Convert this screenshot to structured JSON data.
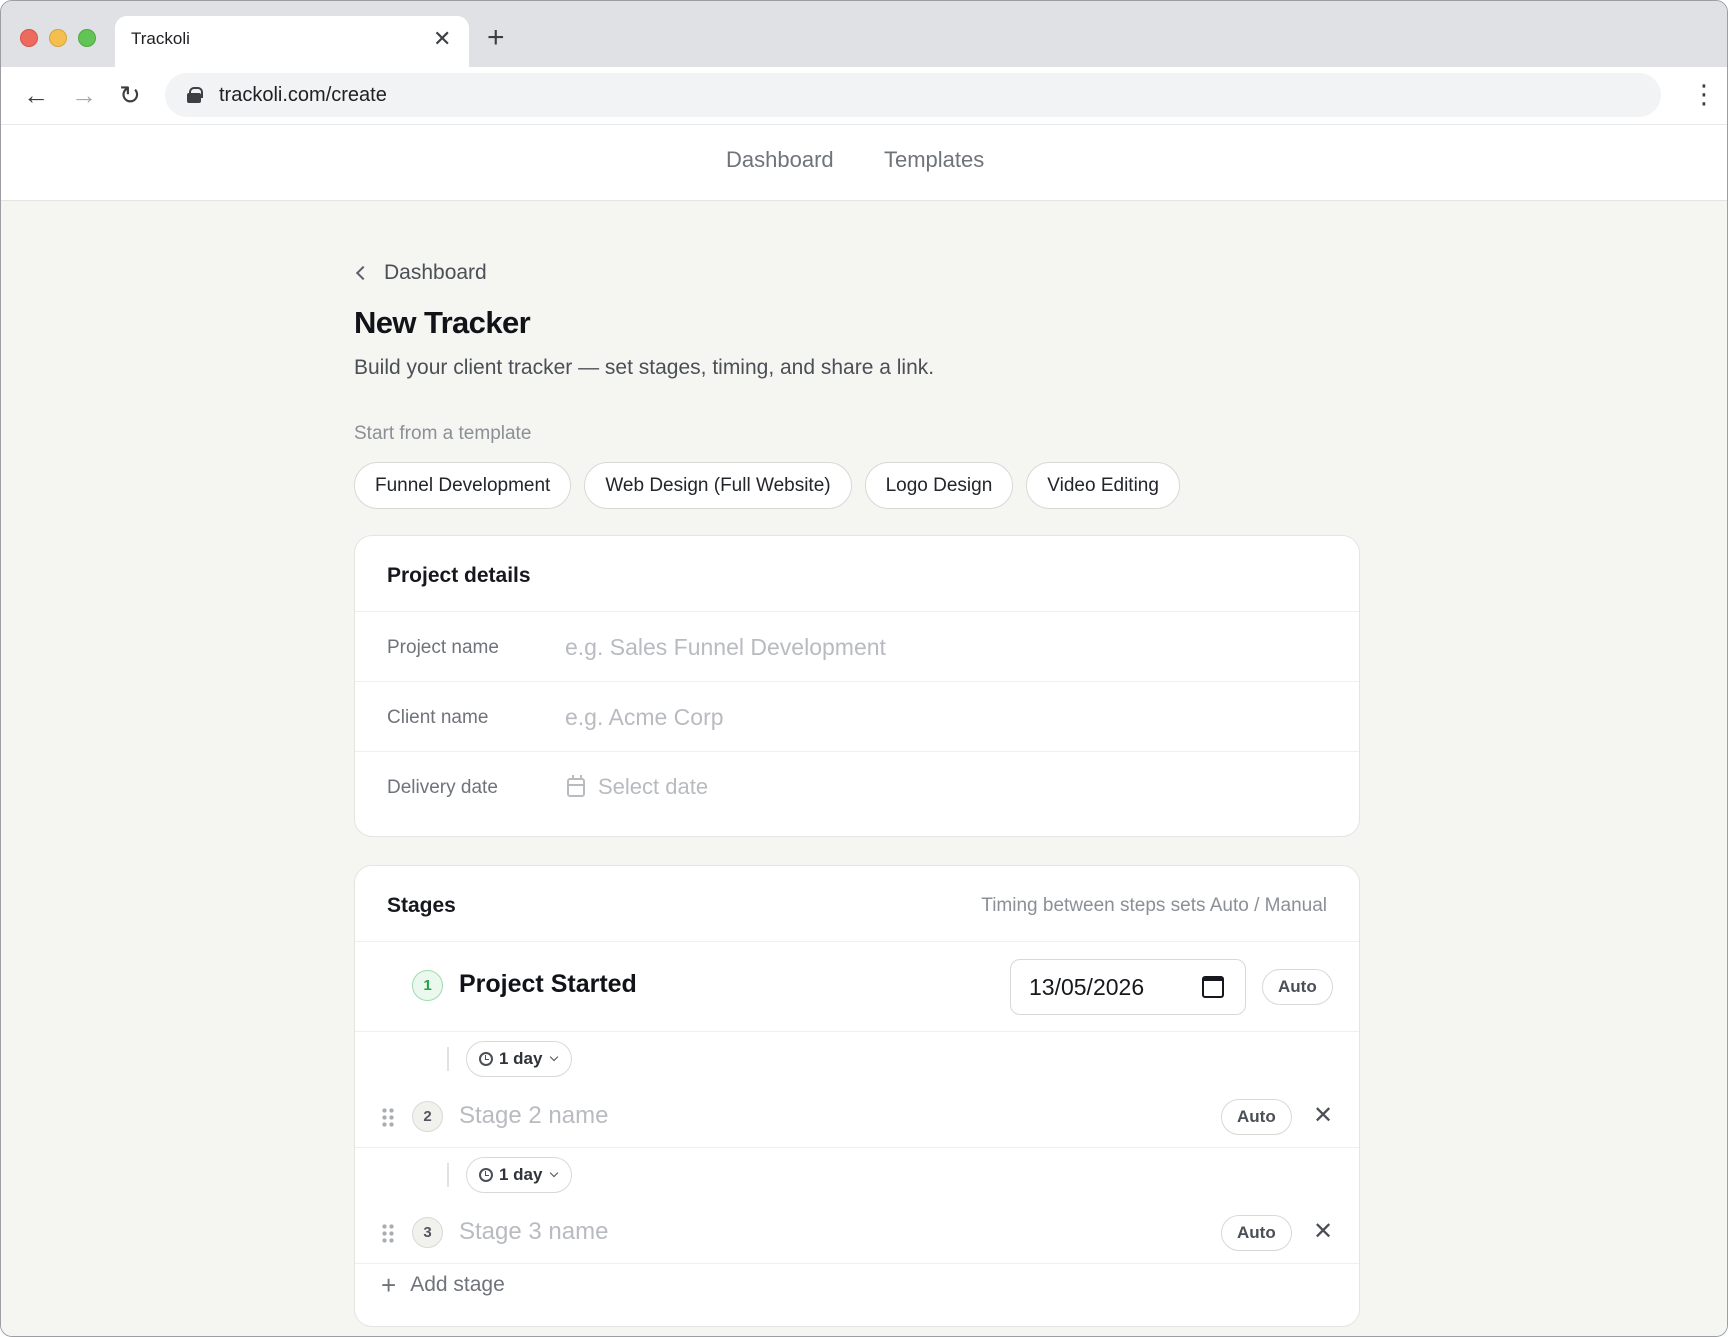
{
  "browser": {
    "tab_title": "Trackoli",
    "url": "trackoli.com/create",
    "icons": {
      "close": "✕",
      "new_tab": "+",
      "back": "←",
      "forward": "→",
      "reload": "↻",
      "menu": "⋮"
    }
  },
  "app_nav": {
    "items": [
      {
        "label": "Dashboard"
      },
      {
        "label": "Templates"
      }
    ]
  },
  "page": {
    "breadcrumb": "Dashboard",
    "title": "New Tracker",
    "subtitle": "Build your client tracker — set stages, timing, and share a link.",
    "template_label": "Start from a template",
    "templates": [
      {
        "label": "Funnel Development"
      },
      {
        "label": "Web Design (Full Website)"
      },
      {
        "label": "Logo Design"
      },
      {
        "label": "Video Editing"
      }
    ]
  },
  "project_details": {
    "title": "Project details",
    "fields": {
      "project_name": {
        "label": "Project name",
        "value": "",
        "placeholder": "e.g. Sales Funnel Development"
      },
      "client_name": {
        "label": "Client name",
        "value": "",
        "placeholder": "e.g. Acme Corp"
      },
      "delivery_date": {
        "label": "Delivery date",
        "placeholder": "Select date"
      }
    }
  },
  "stages": {
    "title": "Stages",
    "hint": "Timing between steps sets Auto / Manual",
    "items": [
      {
        "number": "1",
        "name": "Project Started",
        "date": "13/05/2026",
        "mode": "Auto"
      },
      {
        "number": "2",
        "name": "",
        "placeholder": "Stage 2 name",
        "mode": "Auto"
      },
      {
        "number": "3",
        "name": "",
        "placeholder": "Stage 3 name",
        "mode": "Auto"
      }
    ],
    "gaps": [
      {
        "duration": "1 day"
      },
      {
        "duration": "1 day"
      }
    ],
    "remove_icon": "✕",
    "add_icon": "+",
    "add_label": "Add stage"
  },
  "colors": {
    "background": "#f5f5f2",
    "card": "#ffffff",
    "active_stage": "#26a04a",
    "text_primary": "#111318",
    "text_muted": "#6f737a"
  }
}
